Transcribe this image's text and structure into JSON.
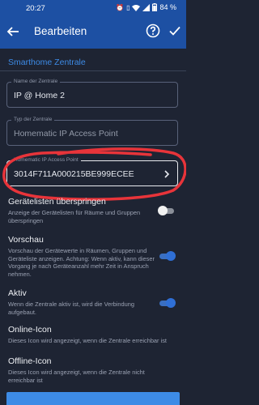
{
  "status": {
    "time": "20:27",
    "battery": "84 %"
  },
  "appbar": {
    "title": "Bearbeiten"
  },
  "section": {
    "title": "Smarthome Zentrale"
  },
  "fields": [
    {
      "label": "Name der Zentrale",
      "value": "IP @ Home 2"
    },
    {
      "label": "Typ der Zentrale",
      "value": "Homematic IP Access Point"
    },
    {
      "label": "Homematic IP Access Point",
      "value": "3014F711A000215BE999ECEE"
    }
  ],
  "settings": [
    {
      "title": "Gerätelisten überspringen",
      "description": "Anzeige der Gerätelisten für Räume und Gruppen überspringen",
      "enabled": false
    },
    {
      "title": "Vorschau",
      "description": "Vorschau der Gerätewerte in Räumen, Gruppen und Geräteliste anzeigen. Achtung: Wenn aktiv, kann dieser Vorgang je nach Geräteanzahl mehr Zeit in Anspruch nehmen.",
      "enabled": true
    },
    {
      "title": "Aktiv",
      "description": "Wenn die Zentrale aktiv ist, wird die Verbindung aufgebaut.",
      "enabled": true
    },
    {
      "title": "Online-Icon",
      "description": "Dieses Icon wird angezeigt, wenn die Zentrale erreichbar ist"
    },
    {
      "title": "Offline-Icon",
      "description": "Dieses Icon wird angezeigt, wenn die Zentrale nicht erreichbar ist"
    }
  ],
  "colors": {
    "appbar": "#1d50a3",
    "background": "#1e2433",
    "accent": "#3d8be6",
    "annotation": "#e8343a"
  },
  "icons": [
    "back-arrow-icon",
    "help-icon",
    "check-icon",
    "chevron-right-icon",
    "wifi-icon",
    "battery-icon"
  ]
}
